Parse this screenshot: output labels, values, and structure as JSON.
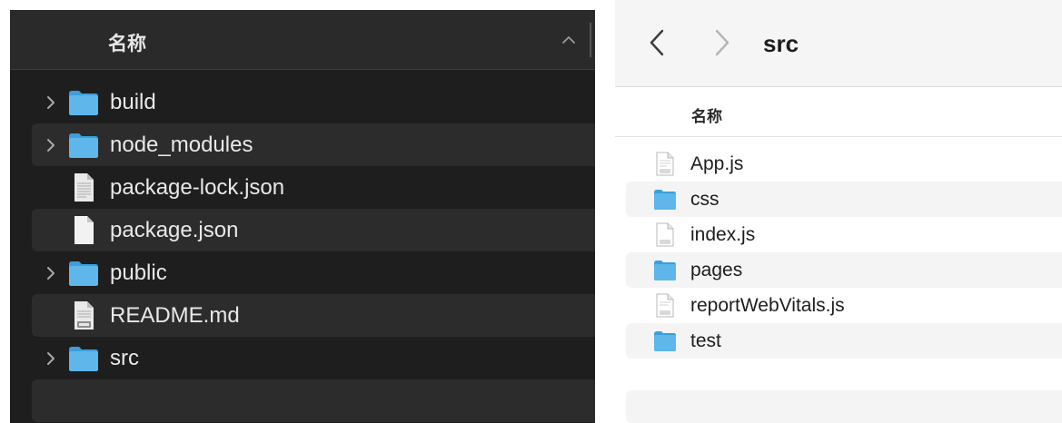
{
  "left_window": {
    "column_header": "名称",
    "sort_icon": "chevron-up-icon",
    "items": [
      {
        "name": "build",
        "type": "folder",
        "expandable": true
      },
      {
        "name": "node_modules",
        "type": "folder",
        "expandable": true
      },
      {
        "name": "package-lock.json",
        "type": "document",
        "expandable": false
      },
      {
        "name": "package.json",
        "type": "blank-document",
        "expandable": false
      },
      {
        "name": "public",
        "type": "folder",
        "expandable": true
      },
      {
        "name": "README.md",
        "type": "md-document",
        "expandable": false
      },
      {
        "name": "src",
        "type": "folder",
        "expandable": true
      }
    ]
  },
  "right_window": {
    "path_title": "src",
    "back_icon": "chevron-left-icon",
    "forward_icon": "chevron-right-icon",
    "column_header": "名称",
    "items": [
      {
        "name": "App.js",
        "type": "js-document"
      },
      {
        "name": "css",
        "type": "folder"
      },
      {
        "name": "index.js",
        "type": "js-document"
      },
      {
        "name": "pages",
        "type": "folder"
      },
      {
        "name": "reportWebVitals.js",
        "type": "js-document"
      },
      {
        "name": "test",
        "type": "folder"
      }
    ]
  },
  "colors": {
    "folder_blue": "#5eb6ea",
    "folder_blue_dark": "#3c9fdc",
    "dark_bg": "#1e1e1e",
    "dark_alt_row": "#2c2c2c",
    "light_alt_row": "#f4f4f4"
  }
}
